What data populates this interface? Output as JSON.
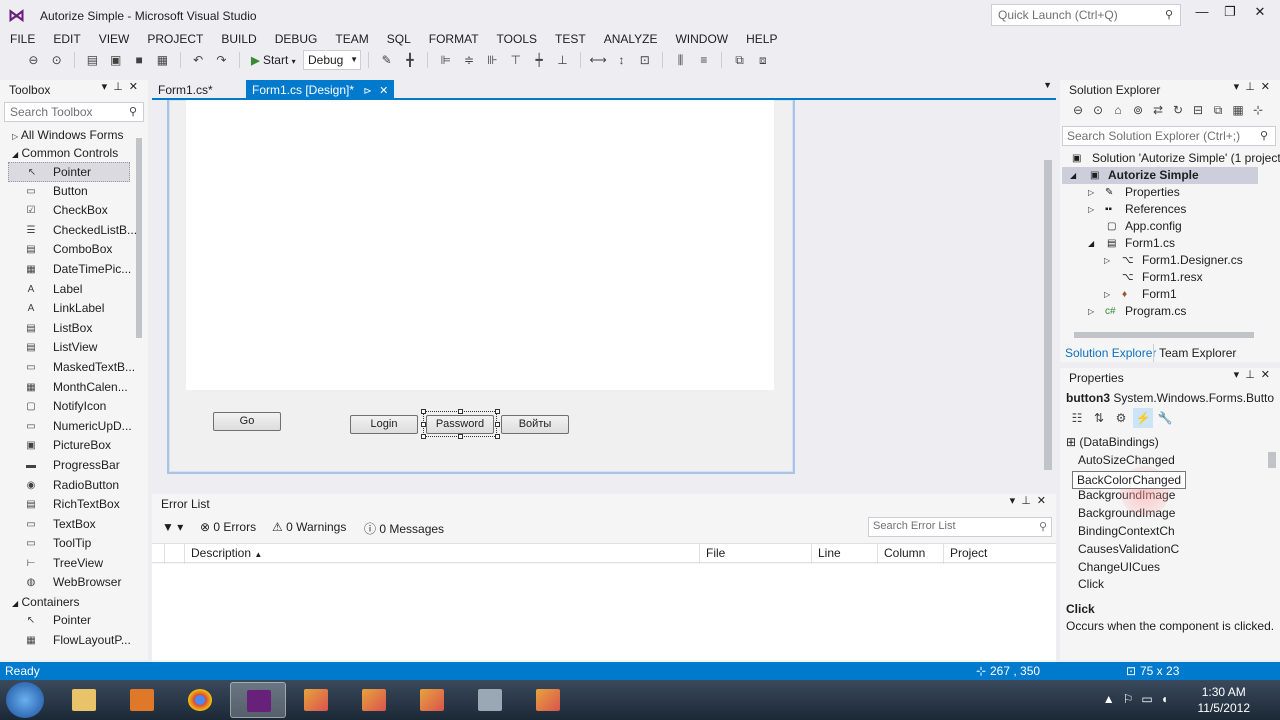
{
  "window": {
    "title": "Autorize Simple - Microsoft Visual Studio",
    "quick_launch_placeholder": "Quick Launch (Ctrl+Q)",
    "minimize": "—",
    "restore": "❐",
    "close": "✕"
  },
  "menu": [
    "FILE",
    "EDIT",
    "VIEW",
    "PROJECT",
    "BUILD",
    "DEBUG",
    "TEAM",
    "SQL",
    "FORMAT",
    "TOOLS",
    "TEST",
    "ANALYZE",
    "WINDOW",
    "HELP"
  ],
  "toolbar": {
    "start_label": "Start",
    "config_value": "Debug"
  },
  "toolbox": {
    "title": "Toolbox",
    "search_placeholder": "Search Toolbox",
    "groups": {
      "all_windows_forms": "All Windows Forms",
      "common_controls": "Common Controls",
      "containers": "Containers"
    },
    "common_items": [
      "Pointer",
      "Button",
      "CheckBox",
      "CheckedListB...",
      "ComboBox",
      "DateTimePic...",
      "Label",
      "LinkLabel",
      "ListBox",
      "ListView",
      "MaskedTextB...",
      "MonthCalen...",
      "NotifyIcon",
      "NumericUpD...",
      "PictureBox",
      "ProgressBar",
      "RadioButton",
      "RichTextBox",
      "TextBox",
      "ToolTip",
      "TreeView",
      "WebBrowser"
    ],
    "container_items": [
      "Pointer",
      "FlowLayoutP..."
    ]
  },
  "tabs": {
    "tab1": "Form1.cs*",
    "tab2": "Form1.cs [Design]*"
  },
  "form": {
    "buttons": {
      "go": "Go",
      "login": "Login",
      "password": "Password",
      "voity": "Войты"
    }
  },
  "error_list": {
    "title": "Error List",
    "errors": "0 Errors",
    "warnings": "0 Warnings",
    "messages": "0 Messages",
    "search_placeholder": "Search Error List",
    "columns": {
      "description": "Description",
      "file": "File",
      "line": "Line",
      "column": "Column",
      "project": "Project"
    }
  },
  "solution_explorer": {
    "title": "Solution Explorer",
    "search_placeholder": "Search Solution Explorer (Ctrl+;)",
    "tree": {
      "solution": "Solution 'Autorize Simple' (1 project)",
      "project": "Autorize Simple",
      "properties": "Properties",
      "references": "References",
      "app_config": "App.config",
      "form1_cs": "Form1.cs",
      "form1_designer": "Form1.Designer.cs",
      "form1_resx": "Form1.resx",
      "form1": "Form1",
      "program_cs": "Program.cs"
    },
    "tab_solution": "Solution Explorer",
    "tab_team": "Team Explorer"
  },
  "properties": {
    "title": "Properties",
    "object_name": "button3",
    "object_type": "System.Windows.Forms.Butto",
    "rows": [
      "(DataBindings)",
      "AutoSizeChanged",
      "BackColorChanged",
      "BackgroundImage",
      "BackgroundImage",
      "BindingContextCh",
      "CausesValidationC",
      "ChangeUICues",
      "Click"
    ],
    "tooltip": "BackColorChanged",
    "desc_title": "Click",
    "desc_text": "Occurs when the component is clicked."
  },
  "status": {
    "ready": "Ready",
    "position": "267 , 350",
    "size": "75 x 23"
  },
  "taskbar": {
    "time": "1:30 AM",
    "date": "11/5/2012"
  }
}
